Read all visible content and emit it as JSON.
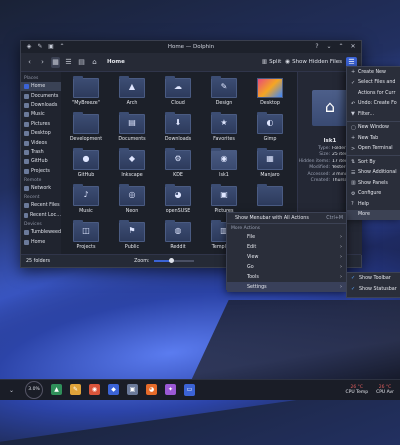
{
  "window": {
    "title": "Home — Dolphin",
    "breadcrumb": "Home",
    "split_label": "Split",
    "hidden_files_label": "Show Hidden Files"
  },
  "sidebar": {
    "sections": [
      {
        "header": "Places",
        "items": [
          {
            "label": "Home",
            "icon": "home-icon",
            "active": true,
            "color": "#3b63d6"
          },
          {
            "label": "Documents",
            "icon": "documents-icon",
            "color": "#6b7a9a"
          },
          {
            "label": "Downloads",
            "icon": "downloads-icon",
            "color": "#6b7a9a"
          },
          {
            "label": "Music",
            "icon": "music-icon",
            "color": "#6b7a9a"
          },
          {
            "label": "Pictures",
            "icon": "pictures-icon",
            "color": "#6b7a9a"
          },
          {
            "label": "Desktop",
            "icon": "desktop-icon",
            "color": "#6b7a9a"
          },
          {
            "label": "Videos",
            "icon": "videos-icon",
            "color": "#6b7a9a"
          },
          {
            "label": "Trash",
            "icon": "trash-icon",
            "color": "#6b7a9a"
          },
          {
            "label": "GitHub",
            "icon": "github-icon",
            "color": "#6b7a9a"
          },
          {
            "label": "Projects",
            "icon": "projects-icon",
            "color": "#6b7a9a"
          }
        ]
      },
      {
        "header": "Remote",
        "items": [
          {
            "label": "Network",
            "icon": "network-icon",
            "color": "#6b7a9a"
          }
        ]
      },
      {
        "header": "Recent",
        "items": [
          {
            "label": "Recent Files",
            "icon": "recent-files-icon",
            "color": "#6b7a9a"
          },
          {
            "label": "Recent Loc…",
            "icon": "recent-locations-icon",
            "color": "#6b7a9a"
          }
        ]
      },
      {
        "header": "Devices",
        "items": [
          {
            "label": "Tumbleweed",
            "icon": "drive-icon",
            "color": "#6b7a9a"
          },
          {
            "label": "Home",
            "icon": "drive-icon",
            "color": "#6b7a9a"
          }
        ]
      }
    ]
  },
  "folders": [
    {
      "label": "\"MyBreeze\"",
      "glyph": ""
    },
    {
      "label": "Arch",
      "glyph": "▲"
    },
    {
      "label": "Cloud",
      "glyph": "☁"
    },
    {
      "label": "Design",
      "glyph": "✎"
    },
    {
      "label": "Desktop",
      "glyph": "",
      "thumb": true
    },
    {
      "label": "Development",
      "glyph": ""
    },
    {
      "label": "Documents",
      "glyph": "▤"
    },
    {
      "label": "Downloads",
      "glyph": "⬇"
    },
    {
      "label": "Favorites",
      "glyph": "★"
    },
    {
      "label": "Gimp",
      "glyph": "◐"
    },
    {
      "label": "GitHub",
      "glyph": "●"
    },
    {
      "label": "Inkscape",
      "glyph": "◆"
    },
    {
      "label": "KDE",
      "glyph": "⚙"
    },
    {
      "label": "lsk1",
      "glyph": "◉"
    },
    {
      "label": "Manjaro",
      "glyph": "▦"
    },
    {
      "label": "Music",
      "glyph": "♪"
    },
    {
      "label": "Neon",
      "glyph": "◎"
    },
    {
      "label": "openSUSE",
      "glyph": "◕"
    },
    {
      "label": "Pictures",
      "glyph": "▣"
    },
    {
      "label": "",
      "glyph": ""
    },
    {
      "label": "Projects",
      "glyph": "◫"
    },
    {
      "label": "Public",
      "glyph": "⚑"
    },
    {
      "label": "Reddit",
      "glyph": "◍"
    },
    {
      "label": "Templates",
      "glyph": "▥"
    },
    {
      "label": "",
      "glyph": ""
    }
  ],
  "info_panel": {
    "name": "lsk1",
    "rows": [
      {
        "key": "Type:",
        "value": "Folder"
      },
      {
        "key": "Size:",
        "value": "25 items"
      },
      {
        "key": "Hidden items:",
        "value": "17 items"
      },
      {
        "key": "Modified:",
        "value": "Yesterday"
      },
      {
        "key": "Accessed:",
        "value": "3 minutes"
      },
      {
        "key": "Created:",
        "value": "Thursday"
      }
    ]
  },
  "status": {
    "count": "25 folders",
    "zoom_label": "Zoom:",
    "zoom_level": 0.45
  },
  "main_menu": {
    "items": [
      {
        "label": "Create New",
        "icon": "+",
        "sep_after": false
      },
      {
        "label": "Select Files and",
        "icon": "✓",
        "sep_after": false
      },
      {
        "label": "Actions for Curr",
        "icon": "",
        "sep_after": false
      },
      {
        "label": "Undo: Create Fo",
        "icon": "↶",
        "sep_after": false
      },
      {
        "label": "Filter...",
        "icon": "▼",
        "sep_after": true
      },
      {
        "label": "New Window",
        "icon": "▢",
        "sep_after": false
      },
      {
        "label": "New Tab",
        "icon": "+",
        "sep_after": false
      },
      {
        "label": "Open Terminal",
        "icon": ">",
        "sep_after": true
      },
      {
        "label": "Sort By",
        "icon": "⇅",
        "sep_after": false
      },
      {
        "label": "Show Additional",
        "icon": "☰",
        "sep_after": false
      },
      {
        "label": "Show Panels",
        "icon": "▥",
        "sep_after": false
      },
      {
        "label": "Configure",
        "icon": "⚙",
        "sep_after": false
      },
      {
        "label": "Help",
        "icon": "?",
        "sep_after": false
      },
      {
        "label": "More",
        "icon": "",
        "sep_after": false,
        "highlight": true
      }
    ]
  },
  "more_menu": {
    "show_menubar": "Show Menubar with All Actions",
    "shortcut": "Ctrl+M",
    "header": "More Actions",
    "items": [
      {
        "label": "File"
      },
      {
        "label": "Edit"
      },
      {
        "label": "View"
      },
      {
        "label": "Go"
      },
      {
        "label": "Tools"
      },
      {
        "label": "Settings",
        "highlight": true
      }
    ]
  },
  "settings_menu": {
    "items": [
      {
        "label": "Show Toolbar"
      },
      {
        "label": "Show Statusbar"
      }
    ]
  },
  "taskbar": {
    "cpu_text": "3.0%",
    "apps": [
      {
        "icon": "terrain-app-icon",
        "glyph": "▲",
        "color": "#2f8f5a"
      },
      {
        "icon": "paint-app-icon",
        "glyph": "✎",
        "color": "#e0a33a"
      },
      {
        "icon": "chrome-icon",
        "glyph": "◉",
        "color": "#d9543b"
      },
      {
        "icon": "app-blue-icon",
        "glyph": "◆",
        "color": "#3b63d6"
      },
      {
        "icon": "image-viewer-icon",
        "glyph": "▣",
        "color": "#6b7a9a"
      },
      {
        "icon": "firefox-icon",
        "glyph": "◕",
        "color": "#e66b2a"
      },
      {
        "icon": "app-purple-icon",
        "glyph": "✦",
        "color": "#9b59d6"
      },
      {
        "icon": "dolphin-icon",
        "glyph": "▭",
        "color": "#3b63d6",
        "active": true
      }
    ],
    "temps": [
      {
        "value": "26 °C",
        "label": "CPU Temp"
      },
      {
        "value": "26 °C",
        "label": "CPU Avr"
      }
    ]
  }
}
